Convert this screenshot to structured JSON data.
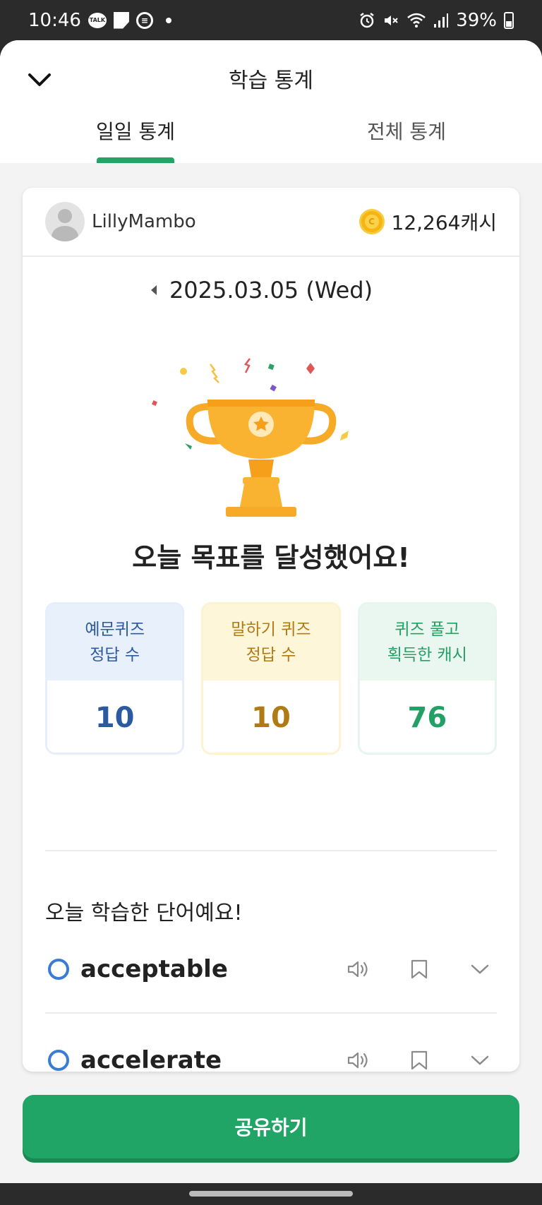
{
  "status_bar": {
    "time": "10:46",
    "battery": "39%",
    "icons_left": [
      "talk-icon",
      "note-icon",
      "circle-s-icon",
      "dot-icon"
    ],
    "icons_right": [
      "alarm-icon",
      "mute-icon",
      "wifi-icon",
      "signal-icon",
      "battery-icon"
    ]
  },
  "header": {
    "title": "학습 통계",
    "back_icon": "chevron-down-icon",
    "tabs": [
      {
        "label": "일일 통계",
        "active": true
      },
      {
        "label": "전체 통계",
        "active": false
      }
    ]
  },
  "user": {
    "name": "LillyMambo",
    "cash": "12,264캐시",
    "coin_glyph": "C"
  },
  "date": {
    "text": "2025.03.05 (Wed)"
  },
  "goal_message": "오늘 목표를 달성했어요!",
  "stats": [
    {
      "line1": "예문퀴즈",
      "line2": "정답 수",
      "value": "10",
      "color": "#2c5aa0"
    },
    {
      "line1": "말하기 퀴즈",
      "line2": "정답 수",
      "value": "10",
      "color": "#b07a17"
    },
    {
      "line1": "퀴즈 풀고",
      "line2": "획득한 캐시",
      "value": "76",
      "color": "#23a064"
    }
  ],
  "words_section": {
    "heading": "오늘 학습한 단어예요!",
    "words": [
      {
        "word": "acceptable"
      },
      {
        "word": "accelerate"
      }
    ]
  },
  "share_button": "공유하기",
  "colors": {
    "accent": "#21a567",
    "trophy": "#f7a928"
  }
}
